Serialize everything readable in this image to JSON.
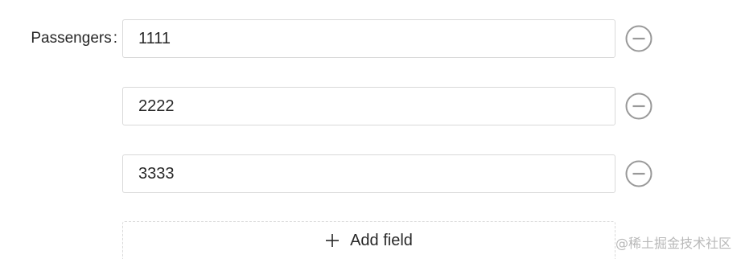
{
  "form": {
    "label": "Passengers",
    "label_colon": ":",
    "fields": [
      {
        "value": "1111"
      },
      {
        "value": "2222"
      },
      {
        "value": "3333"
      }
    ],
    "add_button_label": "Add field"
  },
  "icons": {
    "remove": "minus-circle-icon",
    "add": "plus-icon"
  },
  "watermark": "@稀土掘金技术社区",
  "colors": {
    "border": "#d9d9d9",
    "icon": "#999999",
    "text": "#262626"
  }
}
